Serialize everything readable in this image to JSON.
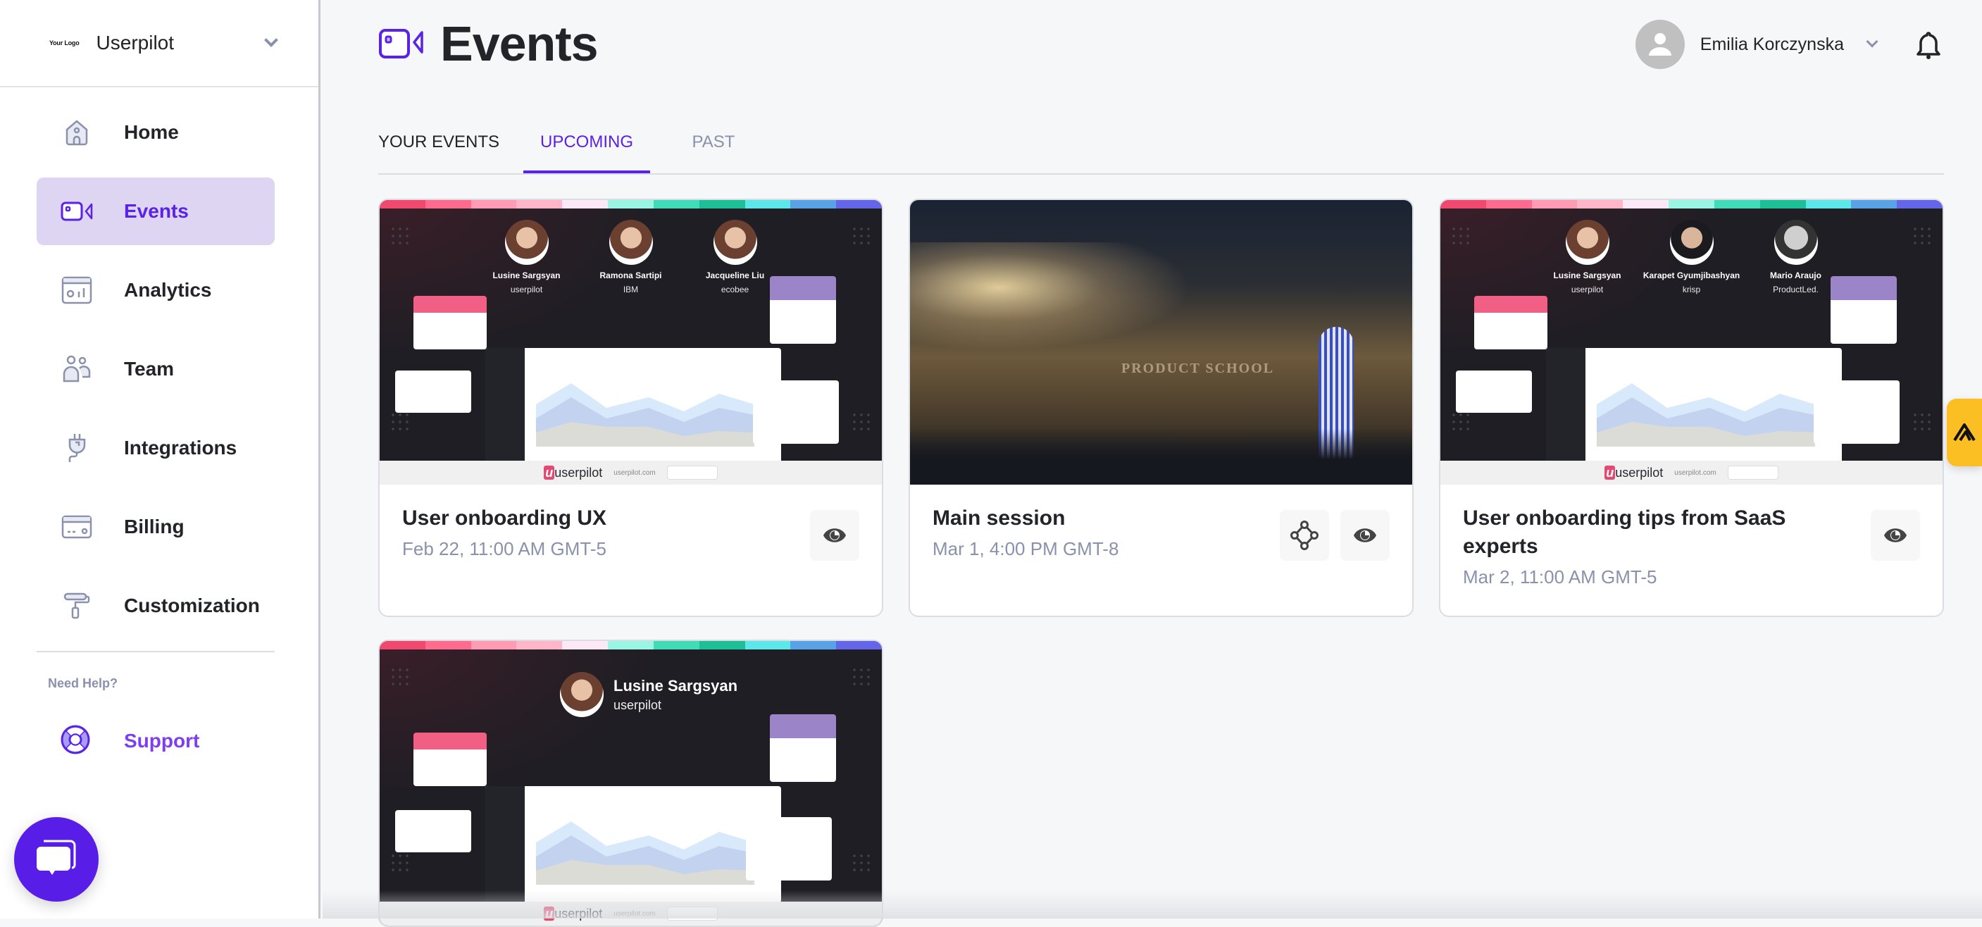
{
  "sidebar": {
    "logo_text": "Your Logo",
    "workspace": "Userpilot",
    "items": [
      {
        "label": "Home",
        "icon": "home-icon"
      },
      {
        "label": "Events",
        "icon": "video-camera-icon",
        "active": true
      },
      {
        "label": "Analytics",
        "icon": "analytics-icon"
      },
      {
        "label": "Team",
        "icon": "team-icon"
      },
      {
        "label": "Integrations",
        "icon": "plug-icon"
      },
      {
        "label": "Billing",
        "icon": "credit-card-icon"
      },
      {
        "label": "Customization",
        "icon": "paint-roller-icon"
      }
    ],
    "help_label": "Need Help?",
    "support_label": "Support"
  },
  "header": {
    "title": "Events",
    "user_name": "Emilia Korczynska"
  },
  "tabs": [
    {
      "label": "YOUR EVENTS"
    },
    {
      "label": "UPCOMING",
      "active": true
    },
    {
      "label": "PAST"
    }
  ],
  "events": [
    {
      "title": "User onboarding UX",
      "date": "Feb 22, 11:00 AM GMT-5",
      "speakers": [
        {
          "name": "Lusine Sargsyan",
          "company": "userpilot"
        },
        {
          "name": "Ramona Sartipi",
          "company": "IBM"
        },
        {
          "name": "Jacqueline Liu",
          "company": "ecobee"
        }
      ],
      "actions": [
        "view"
      ]
    },
    {
      "title": "Main session",
      "date": "Mar 1, 4:00 PM GMT-8",
      "image_text": "PRODUCT SCHOOL",
      "actions": [
        "network",
        "view"
      ]
    },
    {
      "title": "User onboarding tips from SaaS experts",
      "date": "Mar 2, 11:00 AM GMT-5",
      "speakers": [
        {
          "name": "Lusine Sargsyan",
          "company": "userpilot"
        },
        {
          "name": "Karapet Gyumjibashyan",
          "company": "krisp"
        },
        {
          "name": "Mario Araujo",
          "company": "ProductLed."
        }
      ],
      "actions": [
        "view"
      ]
    },
    {
      "title": "",
      "date": "",
      "speakers": [
        {
          "name": "Lusine Sargsyan",
          "company": "userpilot"
        }
      ],
      "actions": []
    }
  ],
  "banner": {
    "brand": "userpilot",
    "url": "userpilot.com"
  },
  "colors": {
    "accent": "#5a21e8",
    "accent_bg": "#ddd5f1",
    "support": "#7c3ef0",
    "muted": "#8a91ad",
    "side_tab": "#fbbf24",
    "stripe": [
      "#f0486e",
      "#ff6b8f",
      "#ff9bb3",
      "#ffb6c8",
      "#fde8f7",
      "#99f6e4",
      "#40dcb8",
      "#1dbf96",
      "#5ce8e8",
      "#5aa2e6",
      "#6366e8"
    ]
  }
}
